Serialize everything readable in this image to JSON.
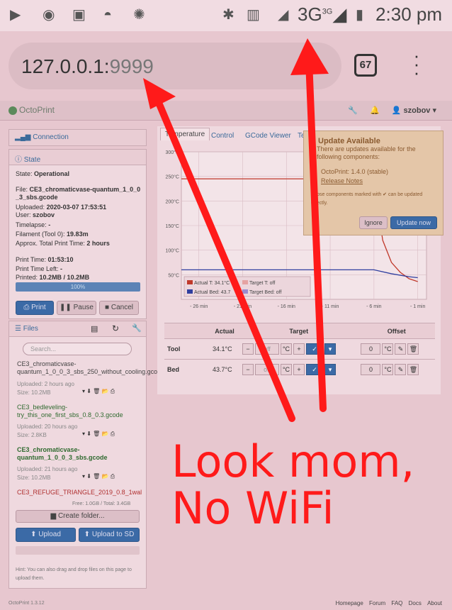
{
  "status_bar": {
    "network": "3G",
    "network_superscript": "3G",
    "time": "2:30 pm",
    "icons": [
      "youtube-icon",
      "messenger-icon",
      "terminal-icon",
      "dome-icon",
      "octopus-icon",
      "bluetooth-icon",
      "vibrate-icon",
      "signal-icon",
      "battery-icon"
    ]
  },
  "browser": {
    "url_host": "127.0.0.1:",
    "url_port": "9999",
    "tab_count": "67",
    "menu_icon": "more-vertical-icon"
  },
  "navbar": {
    "brand": "OctoPrint",
    "wrench_icon": "wrench-icon",
    "bell_icon": "bell-icon",
    "user": "szobov"
  },
  "connection": {
    "label": "Connection"
  },
  "state": {
    "label": "State",
    "state_label": "State:",
    "state_value": "Operational",
    "file_label": "File:",
    "file_value": "CE3_chromaticvase-quantum_1_0_0_3_sbs.gcode",
    "uploaded_label": "Uploaded:",
    "uploaded_value": "2020-03-07 17:53:51",
    "user_label": "User:",
    "user_value": "szobov",
    "timelapse_label": "Timelapse:",
    "timelapse_value": "-",
    "filament_label": "Filament (Tool 0):",
    "filament_value": "19.83m",
    "approx_label": "Approx. Total Print Time:",
    "approx_value": "2 hours",
    "print_time_label": "Print Time:",
    "print_time_value": "01:53:10",
    "time_left_label": "Print Time Left:",
    "time_left_value": "-",
    "printed_label": "Printed:",
    "printed_value": "10.2MB / 10.2MB",
    "progress_text": "100%",
    "progress": 1.0
  },
  "print_buttons": {
    "print": "Print",
    "pause": "Pause",
    "cancel": "Cancel"
  },
  "files": {
    "label": "Files",
    "search_placeholder": "Search...",
    "items": [
      {
        "name": "CE3_chromaticvase-quantum_1_0_0_3_sbs_250_without_cooling.gcode",
        "uploaded": "Uploaded: 2 hours ago",
        "size": "Size: 10.2MB"
      },
      {
        "name": "CE3_bedleveling-try_this_one_first_sbs_0.8_0.3.gcode",
        "uploaded": "Uploaded: 20 hours ago",
        "size": "Size: 2.8KB"
      },
      {
        "name": "CE3_chromaticvase-quantum_1_0_0_3_sbs.gcode",
        "uploaded": "Uploaded: 21 hours ago",
        "size": "Size: 10.2MB"
      },
      {
        "name": "CE3_REFUGE_TRIANGLE_2019_0.8_1wal",
        "uploaded": "",
        "size": ""
      }
    ],
    "free_total": "Free: 1.0GB / Total: 3.4GB",
    "create_folder": "Create folder...",
    "upload": "Upload",
    "upload_sd": "Upload to SD",
    "hint": "Hint: You can also drag and drop files on this page to upload them."
  },
  "tabs": [
    "Temperature",
    "Control",
    "GCode Viewer",
    "Te"
  ],
  "chart_data": {
    "type": "line",
    "x_ticks": [
      "- 26 min",
      "- 21 min",
      "- 16 min",
      "- 11 min",
      "- 6 min",
      "- 1 min"
    ],
    "y_ticks": [
      "300°C",
      "250°C",
      "200°C",
      "150°C",
      "100°C",
      "50°C"
    ],
    "ylim": [
      0,
      300
    ],
    "legend": [
      "Actual T: 34.1°C",
      "Target T: off",
      "Actual Bed: 43.7",
      "Target Bed: off"
    ],
    "series": [
      {
        "name": "Actual T: 34.1°C",
        "color": "#c0392b",
        "x": [
          -28,
          -6.5,
          -6,
          -5,
          -4,
          -3,
          -2,
          -1
        ],
        "y": [
          245,
          245,
          240,
          120,
          75,
          55,
          42,
          36
        ]
      },
      {
        "name": "Actual Bed: 43.7",
        "color": "#2f3f9f",
        "x": [
          -28,
          -6.5,
          -6,
          -4,
          -2,
          -1
        ],
        "y": [
          60,
          60,
          60,
          52,
          46,
          44
        ]
      }
    ]
  },
  "temps": {
    "col_actual": "Actual",
    "col_target": "Target",
    "col_offset": "Offset",
    "rows": [
      {
        "name": "Tool",
        "actual": "34.1°C",
        "target": "off",
        "unit": "°C",
        "offset": "0"
      },
      {
        "name": "Bed",
        "actual": "43.7°C",
        "target": "off",
        "unit": "°C",
        "offset": "0"
      }
    ]
  },
  "update_popup": {
    "title": "Update Available",
    "body": "There are updates available for the following components:",
    "item": "OctoPrint: 1.4.0 (stable)",
    "release_notes": "Release Notes",
    "note": "Those components marked with ✔ can be updated directly.",
    "ignore": "Ignore",
    "update_now": "Update now"
  },
  "annotation": {
    "line1": "Look mom,",
    "line2": "No WiFi"
  },
  "footer": {
    "version": "OctoPrint 1.3.12",
    "links": [
      "Homepage",
      "Forum",
      "FAQ",
      "Docs",
      "About"
    ]
  },
  "colors": {
    "overlay_red": "#ff1a1a",
    "tint": "#e7c7cf"
  }
}
